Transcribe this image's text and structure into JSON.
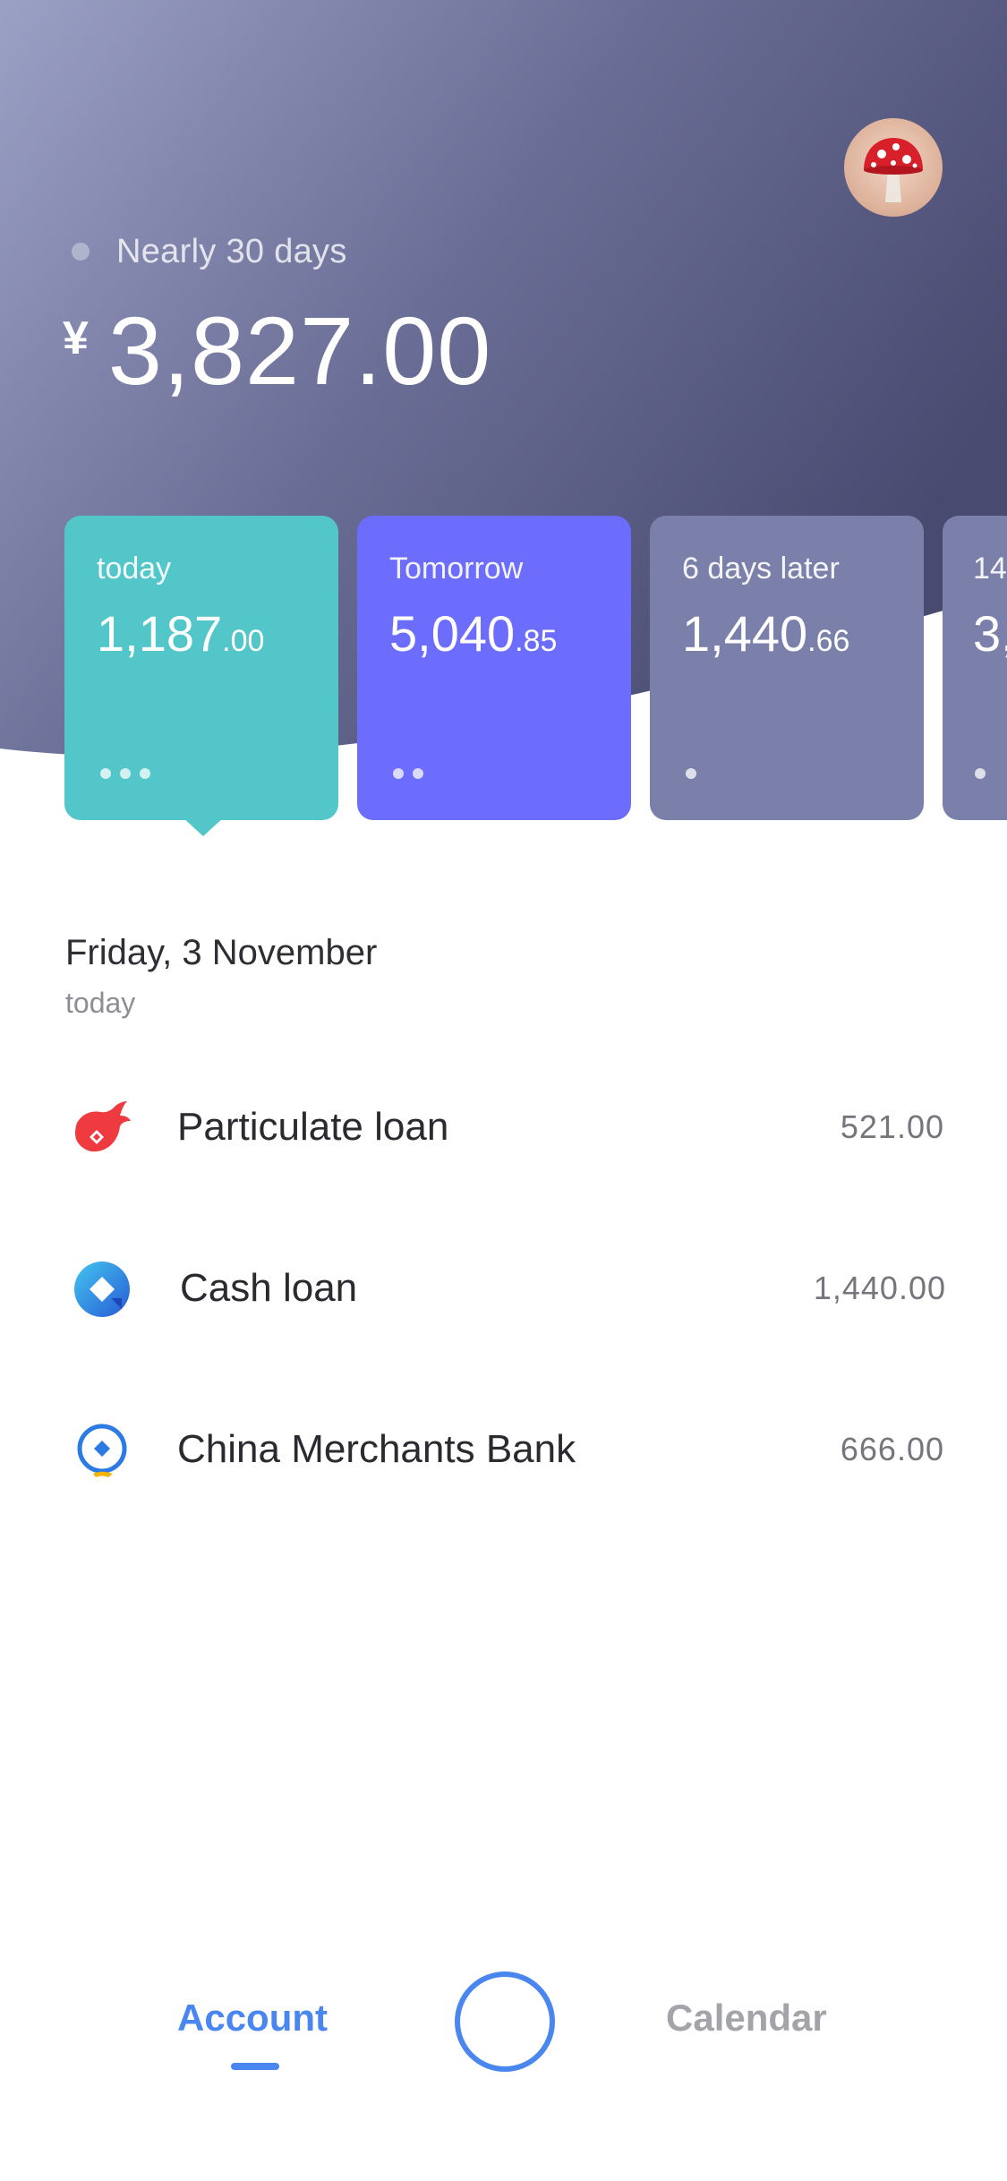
{
  "header": {
    "period_label": "Nearly 30 days",
    "currency": "¥",
    "total_amount": "3,827.00",
    "avatar_icon": "mushroom-avatar-icon",
    "gradient": [
      "#9ba0c5",
      "#6a6d95",
      "#484a70"
    ]
  },
  "cards": [
    {
      "label": "today",
      "amount_int": "1,187",
      "amount_dec": ".00",
      "dots": 3,
      "color": "#52c6c8",
      "selected": true
    },
    {
      "label": "Tomorrow",
      "amount_int": "5,040",
      "amount_dec": ".85",
      "dots": 2,
      "color": "#6c6cfd",
      "selected": false
    },
    {
      "label": "6 days later",
      "amount_int": "1,440",
      "amount_dec": ".66",
      "dots": 1,
      "color": "#7b80ab",
      "selected": false
    },
    {
      "label": "14",
      "amount_int": "3,",
      "amount_dec": "",
      "dots": 1,
      "color": "#7b80ab",
      "selected": false
    }
  ],
  "date": {
    "title": "Friday, 3 November",
    "subtitle": "today"
  },
  "items": [
    {
      "name": "Particulate loan",
      "amount": "521.00",
      "icon": "particulate-loan-logo-icon"
    },
    {
      "name": "Cash loan",
      "amount": "1,440.00",
      "icon": "cash-loan-logo-icon"
    },
    {
      "name": "China Merchants Bank",
      "amount": "666.00",
      "icon": "china-merchants-bank-logo-icon"
    }
  ],
  "nav": {
    "account_label": "Account",
    "calendar_label": "Calendar",
    "active_color": "#4a86f0",
    "inactive_color": "#a3a3aa"
  }
}
